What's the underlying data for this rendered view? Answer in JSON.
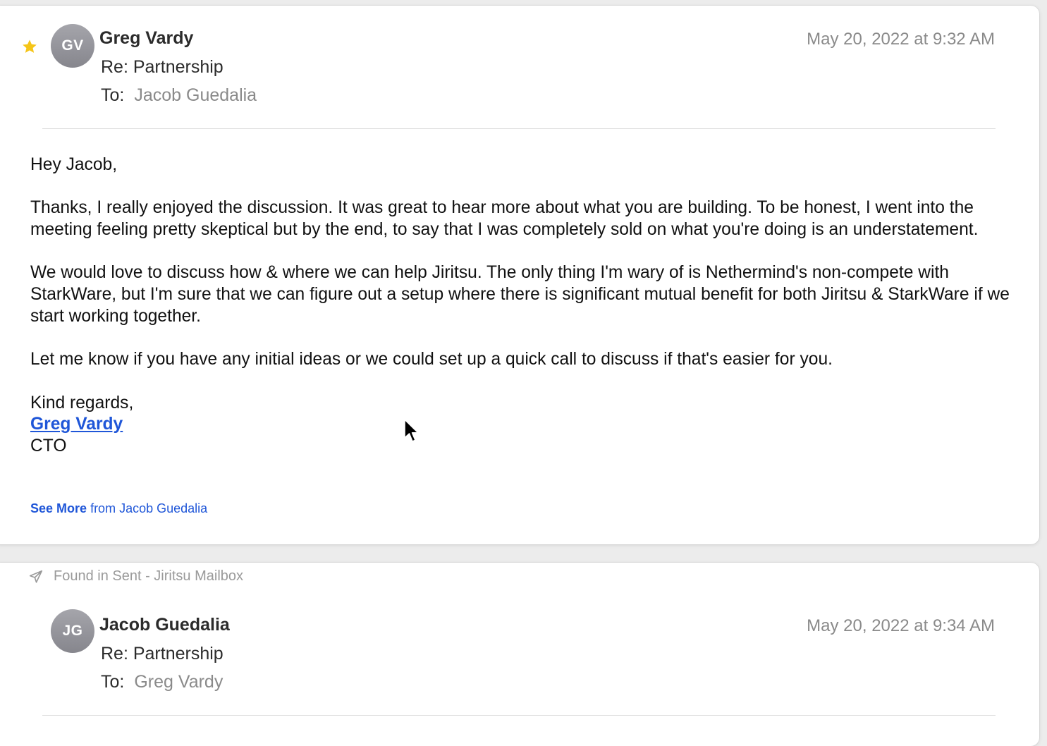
{
  "messages": [
    {
      "starred": true,
      "avatar_initials": "GV",
      "sender": "Greg Vardy",
      "subject": "Re: Partnership",
      "to_label": "To:",
      "to": "Jacob Guedalia",
      "date": "May 20, 2022 at 9:32 AM",
      "body": {
        "greeting": "Hey Jacob,",
        "paragraphs": [
          "Thanks, I really enjoyed the discussion. It was great to hear more about what you are building. To be honest, I went into the meeting feeling pretty skeptical but by the end, to say that I was completely sold on what you're doing is an understatement.",
          "We would love to discuss how & where we can help Jiritsu. The only thing I'm wary of is Nethermind's non-compete with StarkWare, but I'm sure that we can figure out a setup where there is significant mutual benefit for both Jiritsu & StarkWare if we start working together.",
          "Let me know if you have any initial ideas or we could set up a quick call to discuss if that's easier for you."
        ],
        "closing": "Kind regards,",
        "signature_name": "Greg Vardy",
        "signature_title": "CTO"
      },
      "see_more": {
        "bold": "See More",
        "rest": "from Jacob Guedalia"
      }
    },
    {
      "found_in": "Found in Sent - Jiritsu Mailbox",
      "avatar_initials": "JG",
      "sender": "Jacob Guedalia",
      "subject": "Re: Partnership",
      "to_label": "To:",
      "to": "Greg Vardy",
      "date": "May 20, 2022 at 9:34 AM"
    }
  ],
  "colors": {
    "star": "#f5c518",
    "link": "#1f56d8",
    "avatar": "#96969c",
    "muted_text": "#8a8a8a"
  },
  "icons": {
    "star": "star-icon",
    "found_in": "paper-plane-icon",
    "cursor": "mouse-pointer-icon"
  }
}
